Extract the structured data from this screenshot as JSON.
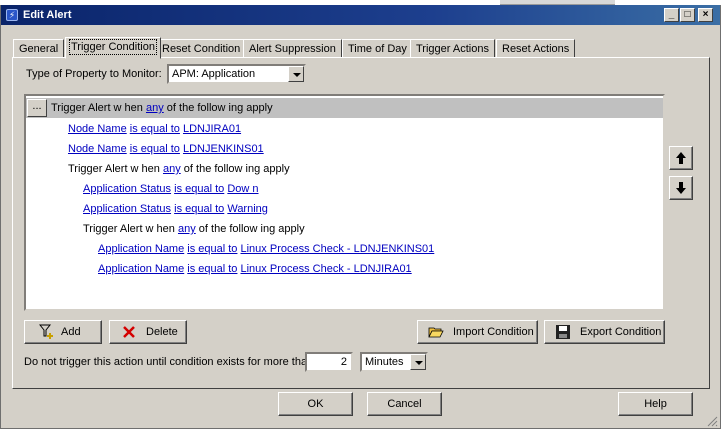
{
  "window": {
    "title": "Edit Alert"
  },
  "tabs": [
    {
      "label": "General"
    },
    {
      "label": "Trigger Condition"
    },
    {
      "label": "Reset Condition"
    },
    {
      "label": "Alert Suppression"
    },
    {
      "label": "Time of Day"
    },
    {
      "label": "Trigger Actions"
    },
    {
      "label": "Reset Actions"
    }
  ],
  "property": {
    "label": "Type of Property to Monitor:",
    "value": "APM: Application"
  },
  "tree": {
    "ellipsis": "...",
    "root": {
      "pre": "Trigger Alert w hen",
      "any": "any",
      "post": "of the follow ing apply"
    },
    "cond1": {
      "field": "Node Name",
      "op": "is equal to",
      "value": "LDNJIRA01"
    },
    "cond2": {
      "field": "Node Name",
      "op": "is equal to",
      "value": "LDNJENKINS01"
    },
    "group1": {
      "pre": "Trigger Alert w hen",
      "any": "any",
      "post": "of the follow ing apply"
    },
    "cond3": {
      "field": "Application Status",
      "op": "is equal to",
      "value": "Dow n"
    },
    "cond4": {
      "field": "Application Status",
      "op": "is equal to",
      "value": "Warning"
    },
    "group2": {
      "pre": "Trigger Alert w hen",
      "any": "any",
      "post": "of the follow ing apply"
    },
    "cond5": {
      "field": "Application Name",
      "op": "is equal to",
      "value": "Linux Process Check - LDNJENKINS01"
    },
    "cond6": {
      "field": "Application Name",
      "op": "is equal to",
      "value": "Linux Process Check - LDNJIRA01"
    }
  },
  "buttons": {
    "add": "Add",
    "delete": "Delete",
    "import": "Import Condition",
    "export": "Export Condition",
    "ok": "OK",
    "cancel": "Cancel",
    "help": "Help"
  },
  "duration": {
    "label": "Do not trigger this action until condition exists for more than",
    "value": "2",
    "unit": "Minutes"
  },
  "colors": {
    "link": "#0000c0",
    "titlebar": "#0a246a",
    "selected_row": "#c0c0c0"
  }
}
